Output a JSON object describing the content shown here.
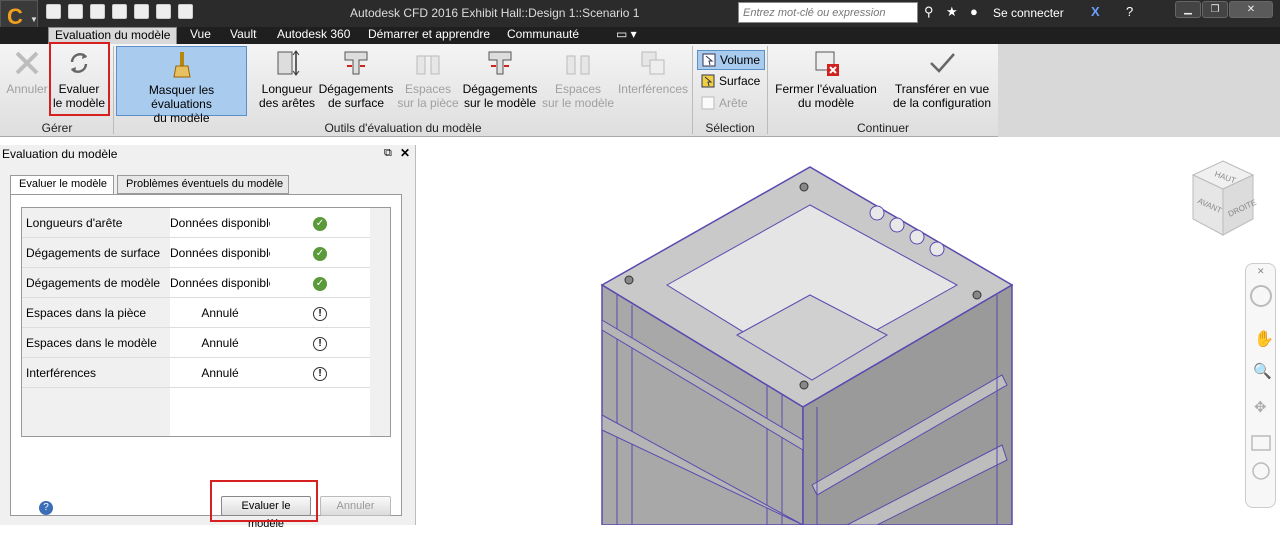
{
  "window": {
    "title": "Autodesk CFD 2016   Exhibit Hall::Design 1::Scenario 1",
    "search_placeholder": "Entrez mot-clé ou expression",
    "connect_label": "Se connecter"
  },
  "ribbon_tabs": [
    "Evaluation du modèle",
    "Vue",
    "Vault",
    "Autodesk 360",
    "Démarrer et apprendre",
    "Communauté"
  ],
  "ribbon": {
    "gerer": {
      "label": "Gérer",
      "annuler": "Annuler",
      "evaluer_l1": "Evaluer",
      "evaluer_l2": "le modèle"
    },
    "outils": {
      "label": "Outils d'évaluation du modèle",
      "masquer_l1": "Masquer les évaluations",
      "masquer_l2": "du modèle",
      "longueur_l1": "Longueur",
      "longueur_l2": "des arêtes",
      "degsurf_l1": "Dégagements",
      "degsurf_l2": "de surface",
      "espaces_piece_l1": "Espaces",
      "espaces_piece_l2": "sur la pièce",
      "degmod_l1": "Dégagements",
      "degmod_l2": "sur le modèle",
      "espaces_mod_l1": "Espaces",
      "espaces_mod_l2": "sur le modèle",
      "interferences": "Interférences"
    },
    "selection": {
      "label": "Sélection",
      "volume": "Volume",
      "surface": "Surface",
      "arete": "Arête"
    },
    "continuer": {
      "label": "Continuer",
      "fermer_l1": "Fermer l'évaluation",
      "fermer_l2": "du modèle",
      "transferer_l1": "Transférer en vue",
      "transferer_l2": "de la configuration"
    }
  },
  "panel": {
    "title": "Evaluation du modèle",
    "tabs": [
      "Evaluer le modèle",
      "Problèmes éventuels du modèle"
    ],
    "rows": [
      {
        "name": "Longueurs d'arête",
        "status": "Données disponible",
        "icon": "ok"
      },
      {
        "name": "Dégagements de surface",
        "status": "Données disponible",
        "icon": "ok"
      },
      {
        "name": "Dégagements de modèle",
        "status": "Données disponible",
        "icon": "ok"
      },
      {
        "name": "Espaces dans la pièce",
        "status": "Annulé",
        "icon": "warn"
      },
      {
        "name": "Espaces dans le modèle",
        "status": "Annulé",
        "icon": "warn"
      },
      {
        "name": "Interférences",
        "status": "Annulé",
        "icon": "warn"
      }
    ],
    "evaluate_button": "Evaluer le modèle",
    "cancel_button": "Annuler"
  },
  "viewcube": {
    "top": "HAUT",
    "front": "AVANT",
    "right": "DROITE"
  },
  "colors": {
    "highlight_red": "#d62020",
    "selected_blue": "#a9cbee",
    "ok_green": "#5a9a3a",
    "model_edge": "#5a4ab0"
  }
}
